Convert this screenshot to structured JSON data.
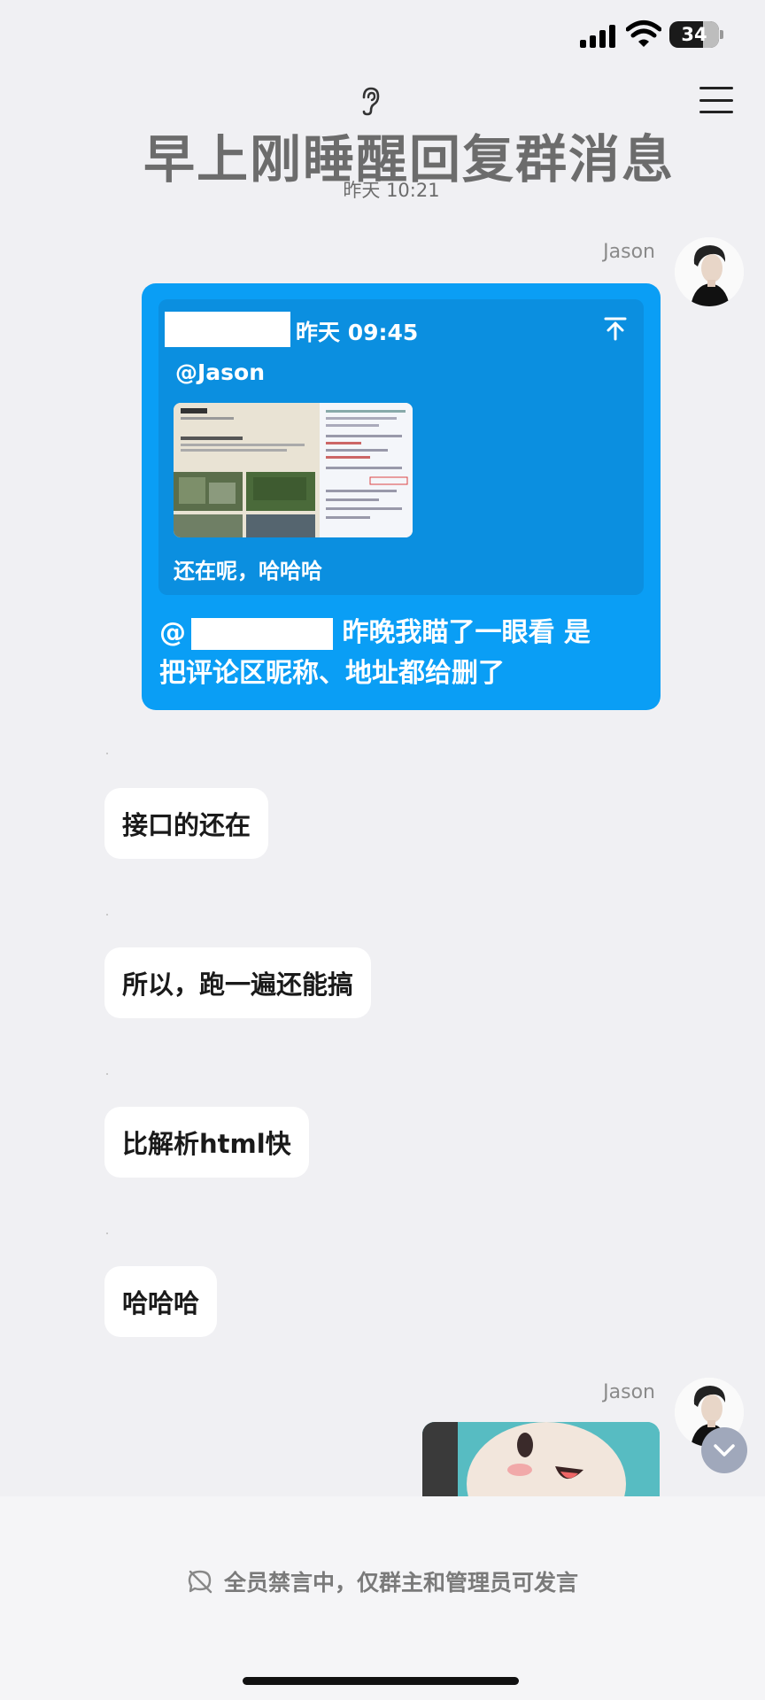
{
  "status_bar": {
    "battery": "34"
  },
  "header": {
    "title": "早上刚睡醒回复群消息",
    "time": "昨天 10:21"
  },
  "msg1": {
    "sender": "Jason",
    "quote": {
      "time": "昨天 09:45",
      "mention": "@Jason",
      "reply": "还在呢，哈哈哈"
    },
    "at": "@",
    "text_after_at": " 昨晚我瞄了一眼看 是",
    "text_line2": "把评论区昵称、地址都给删了"
  },
  "msgs": [
    {
      "text": "接口的还在"
    },
    {
      "text": "所以，跑一遍还能搞"
    },
    {
      "text": "比解析html快"
    },
    {
      "text": "哈哈哈"
    }
  ],
  "msg6": {
    "sender": "Jason"
  },
  "bottom": {
    "mute_notice": "全员禁言中，仅群主和管理员可发言"
  },
  "colors": {
    "blue_bubble": "#0a9ef5",
    "quote_box": "#0b8fe0",
    "background": "#f0f0f3"
  }
}
